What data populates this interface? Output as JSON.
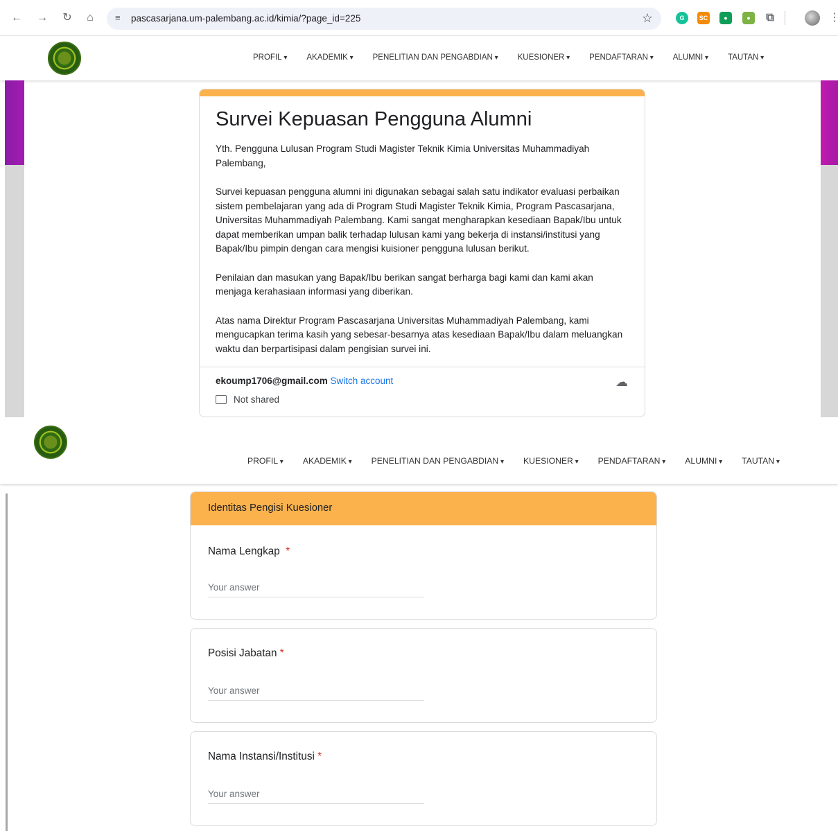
{
  "browser": {
    "back_icon": "←",
    "forward_icon": "→",
    "reload_icon": "↻",
    "home_icon": "⌂",
    "url": "pascasarjana.um-palembang.ac.id/kimia/?page_id=225",
    "star_icon": "☆",
    "extensions": [
      {
        "name": "grammarly",
        "label": "G",
        "color": "#15c39a"
      },
      {
        "name": "sc",
        "label": "SC",
        "color": "#f58a07"
      },
      {
        "name": "bot",
        "label": "●",
        "color": "#0f9d58"
      },
      {
        "name": "green-ext",
        "label": "●",
        "color": "#7cb342"
      },
      {
        "name": "puzzle",
        "label": "⧉",
        "color": "#5f6368"
      }
    ],
    "menu_icon": "⋮"
  },
  "nav": {
    "items": [
      "PROFIL",
      "AKADEMIK",
      "PENELITIAN DAN PENGABDIAN",
      "KUESIONER",
      "PENDAFTARAN",
      "ALUMNI",
      "TAUTAN"
    ]
  },
  "form": {
    "title": "Survei Kepuasan Pengguna Alumni",
    "paragraphs": [
      "Yth. Pengguna Lulusan Program Studi Magister Teknik Kimia Universitas Muhammadiyah Palembang,",
      "Survei kepuasan pengguna alumni ini digunakan sebagai salah satu indikator evaluasi perbaikan sistem pembelajaran yang ada di Program Studi Magister Teknik Kimia, Program Pascasarjana, Universitas Muhammadiyah Palembang. Kami sangat mengharapkan kesediaan Bapak/Ibu untuk dapat memberikan umpan balik terhadap lulusan kami yang bekerja di instansi/institusi yang Bapak/Ibu pimpin dengan cara mengisi kuisioner pengguna lulusan berikut.",
      "Penilaian dan masukan yang Bapak/Ibu berikan sangat berharga bagi kami dan kami akan menjaga kerahasiaan informasi yang diberikan.",
      "Atas nama Direktur Program Pascasarjana Universitas Muhammadiyah Palembang, kami mengucapkan terima kasih yang sebesar-besarnya atas kesediaan Bapak/Ibu dalam meluangkan waktu dan berpartisipasi dalam pengisian survei ini."
    ],
    "email": "ekoump1706@gmail.com",
    "switch_account": "Switch account",
    "not_shared": "Not shared",
    "cloud_icon": "☁"
  },
  "section": {
    "title": "Identitas Pengisi Kuesioner",
    "questions": [
      {
        "label": "Nama Lengkap",
        "required": "*",
        "placeholder": "Your answer"
      },
      {
        "label": "Posisi Jabatan",
        "required": "*",
        "placeholder": "Your answer"
      },
      {
        "label": "Nama Instansi/Institusi",
        "required": "*",
        "placeholder": "Your answer"
      }
    ]
  }
}
